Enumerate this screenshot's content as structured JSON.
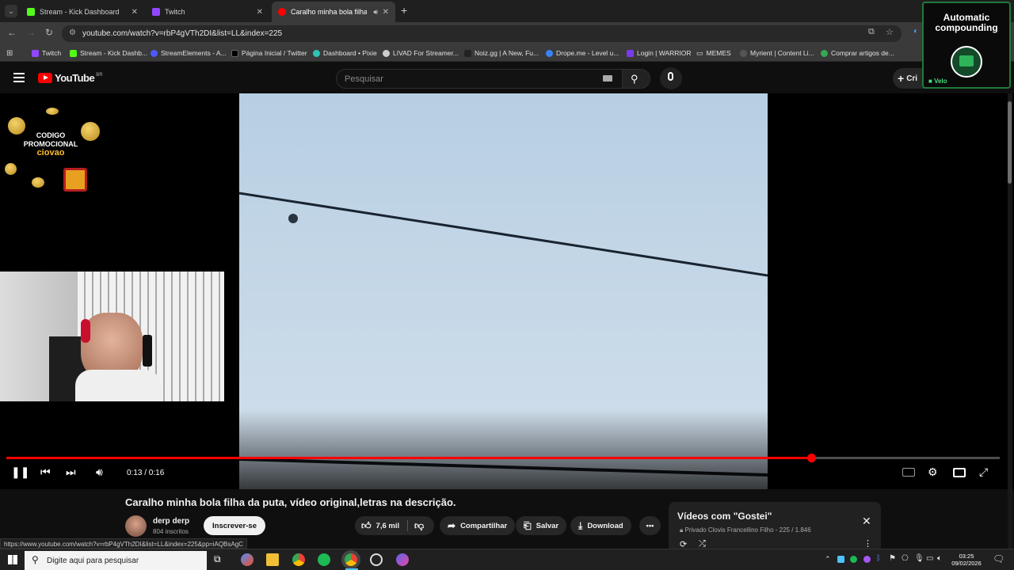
{
  "browser": {
    "tabs": [
      {
        "label": "Stream - Kick Dashboard",
        "color": "#53fc18"
      },
      {
        "label": "Twitch",
        "color": "#9146ff"
      },
      {
        "label": "Caralho minha bola filha da",
        "color": "#ff0000"
      }
    ],
    "url": "youtube.com/watch?v=rbP4gVTh2DI&list=LL&index=225",
    "bookmarks": [
      {
        "label": "Twitch",
        "color": "#9146ff"
      },
      {
        "label": "Stream - Kick Dashb...",
        "color": "#53fc18"
      },
      {
        "label": "StreamElements - A...",
        "color": "#4c5bff"
      },
      {
        "label": "Página Inicial / Twitter",
        "color": "#000000"
      },
      {
        "label": "Dashboard • Pixie",
        "color": "#2ec4b6"
      },
      {
        "label": "LIVAD For Streamer...",
        "color": "#cccccc"
      },
      {
        "label": "Noiz.gg | A New, Fu...",
        "color": "#222222"
      },
      {
        "label": "Drope.me - Level u...",
        "color": "#3b82f6"
      },
      {
        "label": "Login | WARRIOR",
        "color": "#7c3aed"
      },
      {
        "label": "MEMES",
        "color": "#cccccc"
      },
      {
        "label": "Myrient | Content Li...",
        "color": "#555555"
      },
      {
        "label": "Comprar artigos de...",
        "color": "#34a853"
      }
    ]
  },
  "youtube": {
    "logo": "YouTube",
    "region": "BR",
    "search_placeholder": "Pesquisar",
    "create_label": "Cri"
  },
  "player": {
    "time": "0:13 / 0:16",
    "progress": 0.81
  },
  "overlay": {
    "promo_line1": "CODIGO",
    "promo_line2": "PROMOCIONAL",
    "promo_code": "ciovao",
    "compound_title": "Automatic compounding",
    "compound_tag": "Velo"
  },
  "video": {
    "title": "Caralho minha bola filha da puta, vídeo original,letras na descrição.",
    "channel": "derp derp",
    "subscribers": "804 inscritos",
    "subscribe_label": "Inscrever-se",
    "likes": "7,6 mil",
    "share_label": "Compartilhar",
    "save_label": "Salvar",
    "download_label": "Download"
  },
  "playlist": {
    "title": "Vídeos com \"Gostei\"",
    "privacy": "Privado",
    "owner_progress": "Clovis Francellino Filho - 225 / 1.846"
  },
  "status_url": "https://www.youtube.com/watch?v=rbP4gVTh2DI&list=LL&index=225&pp=iAQBsAgC",
  "taskbar": {
    "search_placeholder": "Digite aqui para pesquisar",
    "time": "03:25",
    "date": "09/02/2026"
  }
}
